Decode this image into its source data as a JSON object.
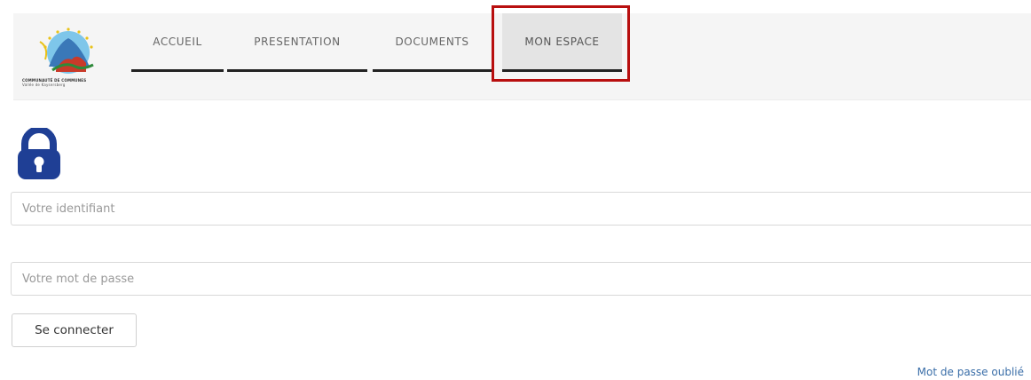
{
  "nav": {
    "items": [
      {
        "label": "ACCUEIL"
      },
      {
        "label": "PRESENTATION"
      },
      {
        "label": "DOCUMENTS"
      },
      {
        "label": "MON ESPACE",
        "active": true
      }
    ]
  },
  "logo": {
    "line1": "COMMUNAUTÉ DE COMMUNES",
    "line2": "Vallée de Kaysersberg"
  },
  "login": {
    "username_placeholder": "Votre identifiant",
    "username_value": "",
    "password_placeholder": "Votre mot de passe",
    "password_value": "",
    "submit_label": "Se connecter",
    "forgot_label": "Mot de passe oublié"
  },
  "icons": {
    "lock": "lock-icon",
    "logo": "logo-emblem"
  },
  "colors": {
    "highlight": "#b80f0f",
    "lock": "#1f3f95",
    "link": "#3a6ea8",
    "nav_underline": "#222222",
    "nav_background": "#f5f5f5",
    "nav_active_background": "#e4e4e4"
  }
}
